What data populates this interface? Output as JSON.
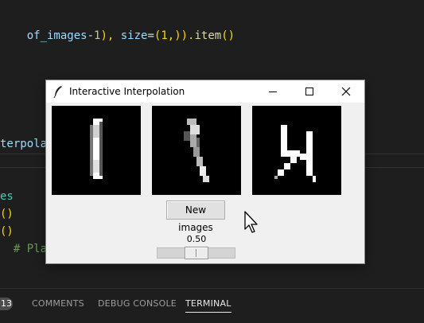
{
  "editor": {
    "line1": {
      "a": "of_images",
      "b": "-",
      "c": "1",
      "d": "), ",
      "e": "size",
      "f": "=",
      "g": "(1,)",
      "h": ").",
      "i": "item",
      "j": "()"
    },
    "line2": {
      "a": "terpola"
    },
    "line3": {
      "a": "es"
    },
    "line4": {
      "a": "()"
    },
    "line5": {
      "a": "()"
    },
    "line6": {
      "a": "  # Plac"
    }
  },
  "panel": {
    "badge": "13",
    "tabs": [
      {
        "label": "COMMENTS"
      },
      {
        "label": "DEBUG CONSOLE"
      },
      {
        "label": "TERMINAL"
      }
    ]
  },
  "window": {
    "title": "Interactive Interpolation",
    "new_images_label": "New images",
    "slider": {
      "value_text": "0.50",
      "value": 0.5
    }
  },
  "colors": {
    "editor_bg": "#1e1e1e",
    "window_bg": "#f0f0f0"
  }
}
